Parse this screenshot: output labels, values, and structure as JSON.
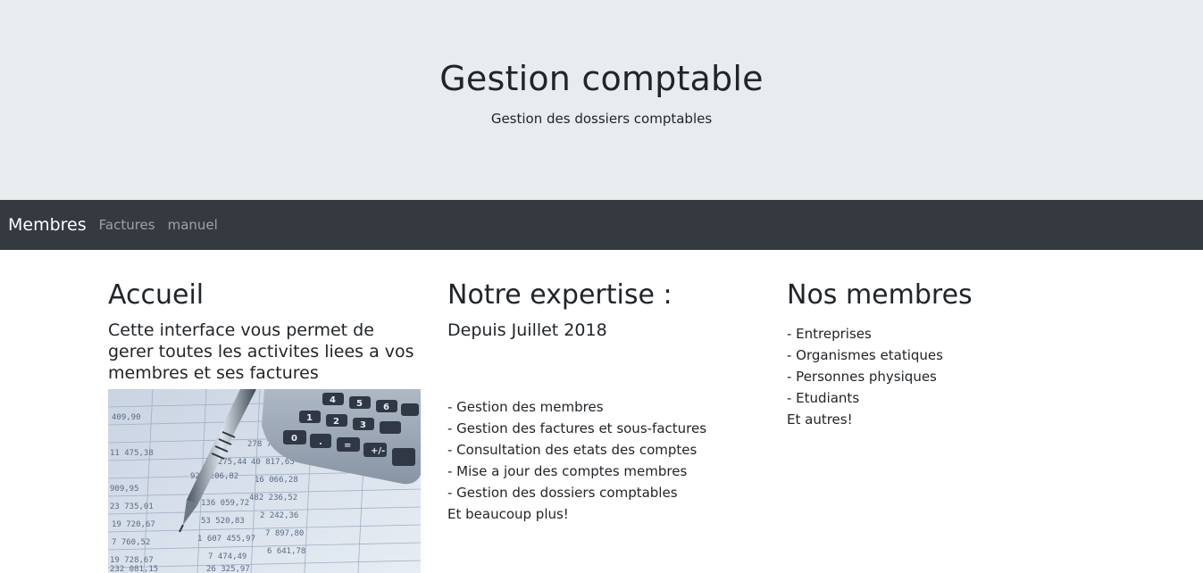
{
  "header": {
    "title": "Gestion comptable",
    "subtitle": "Gestion des dossiers comptables"
  },
  "navbar": {
    "brand": "Membres",
    "links": [
      "Factures",
      "manuel"
    ]
  },
  "columns": [
    {
      "heading": "Accueil",
      "lead": "Cette interface vous permet de gerer toutes les activites liees a vos membres et ses factures",
      "image": "calculator-spreadsheet-photo"
    },
    {
      "heading": "Notre expertise :",
      "lead": "Depuis Juillet 2018",
      "items": [
        "- Gestion des membres",
        "- Gestion des factures et sous-factures",
        "- Consultation des etats des comptes",
        "- Mise a jour des comptes membres",
        "- Gestion des dossiers comptables"
      ],
      "tail": "Et beaucoup plus!"
    },
    {
      "heading": "Nos membres",
      "items": [
        "- Entreprises",
        "- Organismes etatiques",
        "- Personnes physiques",
        "- Etudiants"
      ],
      "tail": "Et autres!"
    }
  ],
  "colors": {
    "jumbotron_bg": "#e9ecef",
    "navbar_bg": "#343a40",
    "nav_link": "#9da2a7",
    "text": "#212529"
  }
}
